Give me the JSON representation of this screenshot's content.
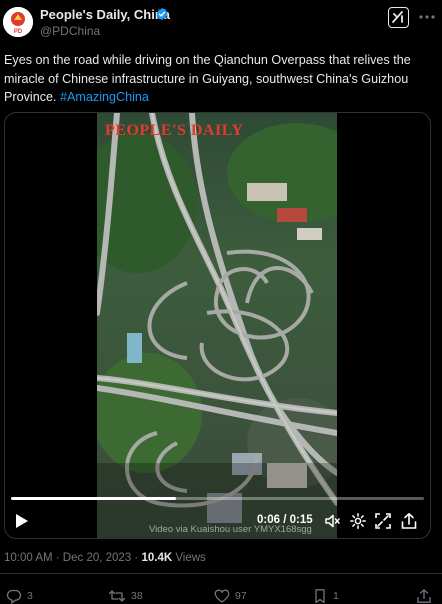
{
  "author": {
    "name": "People's Daily, China",
    "handle": "@PDChina",
    "avatar_text": "PD"
  },
  "tweet": {
    "text": "Eyes on the road while driving on the Qianchun Overpass that relives the miracle of Chinese infrastructure in Guiyang, southwest China's Guizhou Province.",
    "hashtag": "#AmazingChina"
  },
  "video": {
    "watermark": "PEOPLE'S DAILY",
    "caption": "Video via Kuaishou user YMYX168sgg",
    "current_time": "0:06",
    "duration": "0:15",
    "time_separator": " / ",
    "progress": 0.4
  },
  "meta": {
    "timestamp": "10:00 AM · Dec 20, 2023",
    "dot": " · ",
    "views_count": "10.4K",
    "views_label": " Views"
  },
  "actions": {
    "replies": "3",
    "reposts": "38",
    "likes": "97",
    "bookmarks": "1"
  },
  "colors": {
    "background": "#000000",
    "text": "#e7e9ea",
    "muted": "#71767b",
    "accent": "#1d9bf0",
    "watermark": "#e23b2e"
  }
}
